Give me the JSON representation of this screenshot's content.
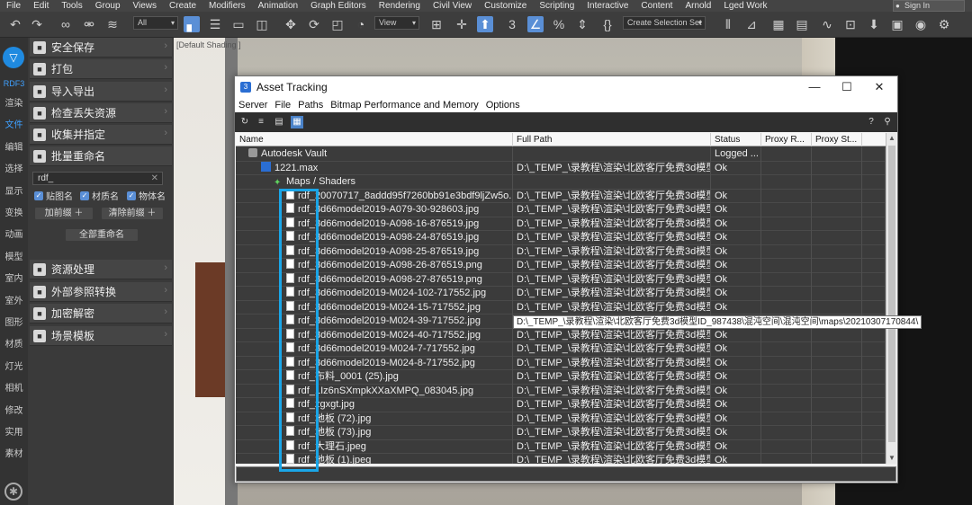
{
  "menubar": {
    "items": [
      "File",
      "Edit",
      "Tools",
      "Group",
      "Views",
      "Create",
      "Modifiers",
      "Animation",
      "Graph Editors",
      "Rendering",
      "Civil View",
      "Customize",
      "Scripting",
      "Interactive",
      "Content",
      "Arnold",
      "Lged Work"
    ],
    "signin": "Sign In"
  },
  "toolbar": {
    "filter_value": "All",
    "view_value": "View",
    "selection_set_placeholder": "Create Selection Set",
    "percent_symbol": "%",
    "three_symbol": "3"
  },
  "leftbar": {
    "logo_label": "RDF3",
    "categories": [
      "渲染",
      "文件",
      "编辑",
      "选择",
      "显示",
      "变换",
      "动画",
      "模型",
      "室内",
      "室外",
      "图形",
      "材质",
      "灯光",
      "相机",
      "修改",
      "实用",
      "素材"
    ],
    "active_category": "文件"
  },
  "panel": {
    "items_top": [
      "安全保存",
      "打包",
      "导入导出",
      "检查丢失资源",
      "收集并指定",
      "批量重命名"
    ],
    "rename_input": "rdf_",
    "checkboxes": [
      "贴图名",
      "材质名",
      "物体名"
    ],
    "add_prefix": "加前缀",
    "remove_prefix": "清除前缀",
    "rename_all": "全部重命名",
    "items_bottom": [
      "资源处理",
      "外部参照转换",
      "加密解密",
      "场景模板"
    ]
  },
  "viewport": {
    "label": "[Default Shading ]"
  },
  "window": {
    "title": "Asset Tracking",
    "menu": [
      "Server",
      "File",
      "Paths",
      "Bitmap Performance and Memory",
      "Options"
    ],
    "columns": [
      "Name",
      "Full Path",
      "Status",
      "Proxy R...",
      "Proxy St..."
    ],
    "rows": [
      {
        "name": "Autodesk Vault",
        "path": "",
        "status": "Logged ...",
        "icon": "vault",
        "indent": 14
      },
      {
        "name": "1221.max",
        "path": "D:\\_TEMP_\\录教程\\渲染\\北欧客厅免费3d模型I...",
        "status": "Ok",
        "icon": "max",
        "indent": 28
      },
      {
        "name": "Maps / Shaders",
        "path": "",
        "status": "",
        "icon": "maps",
        "indent": 42
      },
      {
        "name": "rdf_20070717_8addd95f7260bb91e3bdf9ljZw5o...",
        "path": "D:\\_TEMP_\\录教程\\渲染\\北欧客厅免费3d模型I...",
        "status": "Ok",
        "icon": "file",
        "indent": 56
      },
      {
        "name": "rdf_3d66model2019-A079-30-928603.jpg",
        "path": "D:\\_TEMP_\\录教程\\渲染\\北欧客厅免费3d模型I...",
        "status": "Ok",
        "icon": "file",
        "indent": 56
      },
      {
        "name": "rdf_3d66model2019-A098-16-876519.jpg",
        "path": "D:\\_TEMP_\\录教程\\渲染\\北欧客厅免费3d模型I...",
        "status": "Ok",
        "icon": "file",
        "indent": 56
      },
      {
        "name": "rdf_3d66model2019-A098-24-876519.jpg",
        "path": "D:\\_TEMP_\\录教程\\渲染\\北欧客厅免费3d模型I...",
        "status": "Ok",
        "icon": "file",
        "indent": 56
      },
      {
        "name": "rdf_3d66model2019-A098-25-876519.jpg",
        "path": "D:\\_TEMP_\\录教程\\渲染\\北欧客厅免费3d模型I...",
        "status": "Ok",
        "icon": "file",
        "indent": 56
      },
      {
        "name": "rdf_3d66model2019-A098-26-876519.png",
        "path": "D:\\_TEMP_\\录教程\\渲染\\北欧客厅免费3d模型I...",
        "status": "Ok",
        "icon": "file",
        "indent": 56
      },
      {
        "name": "rdf_3d66model2019-A098-27-876519.png",
        "path": "D:\\_TEMP_\\录教程\\渲染\\北欧客厅免费3d模型I...",
        "status": "Ok",
        "icon": "file",
        "indent": 56
      },
      {
        "name": "rdf_3d66model2019-M024-102-717552.jpg",
        "path": "D:\\_TEMP_\\录教程\\渲染\\北欧客厅免费3d模型I...",
        "status": "Ok",
        "icon": "file",
        "indent": 56
      },
      {
        "name": "rdf_3d66model2019-M024-15-717552.jpg",
        "path": "D:\\_TEMP_\\录教程\\渲染\\北欧客厅免费3d模型I...",
        "status": "Ok",
        "icon": "file",
        "indent": 56
      },
      {
        "name": "rdf_3d66model2019-M024-39-717552.jpg",
        "path": "",
        "status": "",
        "icon": "file",
        "indent": 56
      },
      {
        "name": "rdf_3d66model2019-M024-40-717552.jpg",
        "path": "D:\\_TEMP_\\录教程\\渲染\\北欧客厅免费3d模型I...",
        "status": "Ok",
        "icon": "file",
        "indent": 56
      },
      {
        "name": "rdf_3d66model2019-M024-7-717552.jpg",
        "path": "D:\\_TEMP_\\录教程\\渲染\\北欧客厅免费3d模型I...",
        "status": "Ok",
        "icon": "file",
        "indent": 56
      },
      {
        "name": "rdf_3d66model2019-M024-8-717552.jpg",
        "path": "D:\\_TEMP_\\录教程\\渲染\\北欧客厅免费3d模型I...",
        "status": "Ok",
        "icon": "file",
        "indent": 56
      },
      {
        "name": "rdf_布料_0001 (25).jpg",
        "path": "D:\\_TEMP_\\录教程\\渲染\\北欧客厅免费3d模型I...",
        "status": "Ok",
        "icon": "file",
        "indent": 56
      },
      {
        "name": "rdf_1Iz6nSXmpkXXaXMPQ_083045.jpg",
        "path": "D:\\_TEMP_\\录教程\\渲染\\北欧客厅免费3d模型I...",
        "status": "Ok",
        "icon": "file",
        "indent": 56
      },
      {
        "name": "rdf_zgxgt.jpg",
        "path": "D:\\_TEMP_\\录教程\\渲染\\北欧客厅免费3d模型I...",
        "status": "Ok",
        "icon": "file",
        "indent": 56
      },
      {
        "name": "rdf_地板 (72).jpg",
        "path": "D:\\_TEMP_\\录教程\\渲染\\北欧客厅免费3d模型I...",
        "status": "Ok",
        "icon": "file",
        "indent": 56
      },
      {
        "name": "rdf_地板 (73).jpg",
        "path": "D:\\_TEMP_\\录教程\\渲染\\北欧客厅免费3d模型I...",
        "status": "Ok",
        "icon": "file",
        "indent": 56
      },
      {
        "name": "rdf_大理石.jpeg",
        "path": "D:\\_TEMP_\\录教程\\渲染\\北欧客厅免费3d模型I...",
        "status": "Ok",
        "icon": "file",
        "indent": 56
      },
      {
        "name": "rdf_地板 (1).jpeg",
        "path": "D:\\_TEMP_\\录教程\\渲染\\北欧客厅免费3d模型I...",
        "status": "Ok",
        "icon": "file",
        "indent": 56
      }
    ],
    "tooltip": "D:\\_TEMP_\\录教程\\渲染\\北欧客厅免费3d模型ID_987438\\混沌空间\\混沌空间\\maps\\20210307170844\\"
  },
  "colors": {
    "highlight": "#1aa6e8",
    "accent": "#5a8fd6",
    "logo": "#1f8ae0"
  }
}
